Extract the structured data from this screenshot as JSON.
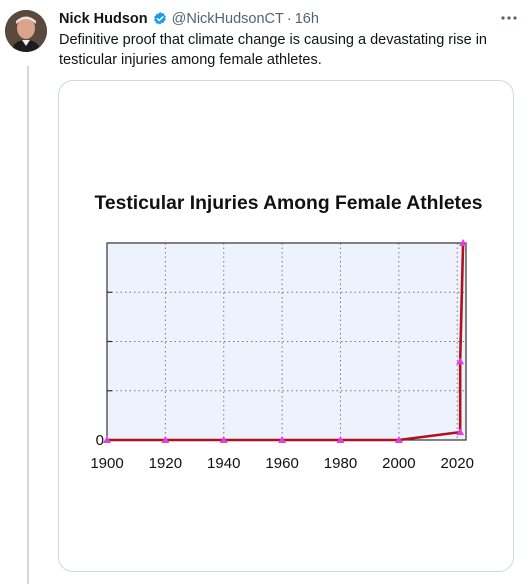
{
  "tweet": {
    "author_name": "Nick Hudson",
    "handle": "@NickHudsonCT",
    "separator": "·",
    "time": "16h",
    "text": "Definitive proof that climate change is causing a devastating rise in testicular injuries among female athletes.",
    "verified_color": "#1d9bf0",
    "more_icon": "more-icon"
  },
  "chart_data": {
    "type": "line",
    "title": "Testicular Injuries Among Female Athletes",
    "xlabel": "",
    "ylabel": "",
    "x_ticks": [
      "1900",
      "1920",
      "1940",
      "1960",
      "1980",
      "2000",
      "2020"
    ],
    "y_ticks": [
      "0"
    ],
    "xlim": [
      1900,
      2023
    ],
    "ylim": [
      0,
      100
    ],
    "grid": true,
    "series": [
      {
        "color": "#b01020",
        "marker_color": "#e040e0",
        "x": [
          1900,
          1920,
          1940,
          1960,
          1980,
          2000,
          2021,
          2021,
          2022
        ],
        "y": [
          0,
          0,
          0,
          0,
          0,
          0,
          4,
          40,
          100
        ]
      }
    ]
  }
}
